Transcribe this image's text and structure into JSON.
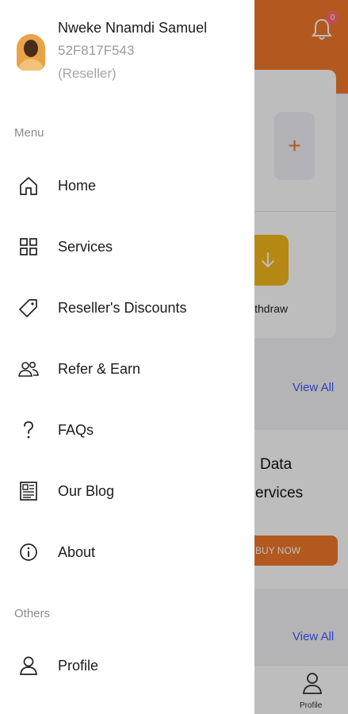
{
  "user": {
    "name": "Nweke Nnamdi Samuel",
    "id": "52F817F543",
    "role": "(Reseller)"
  },
  "sections": {
    "menu": "Menu",
    "others": "Others"
  },
  "nav": {
    "home": "Home",
    "services": "Services",
    "discounts": "Reseller's Discounts",
    "refer": "Refer & Earn",
    "faqs": "FAQs",
    "blog": "Our Blog",
    "about": "About",
    "profile": "Profile"
  },
  "background": {
    "notification_count": "0",
    "plus": "+",
    "withdraw_label": "ithdraw",
    "view_all_1": "View All",
    "view_all_2": "View All",
    "promo_line1": "Data",
    "promo_line2": "ervices",
    "buy_now": "BUY NOW",
    "bottom_profile_label": "Profile"
  },
  "colors": {
    "brand_orange": "#f2782a",
    "accent_yellow": "#f5b81b",
    "link_blue": "#3d5bff"
  }
}
